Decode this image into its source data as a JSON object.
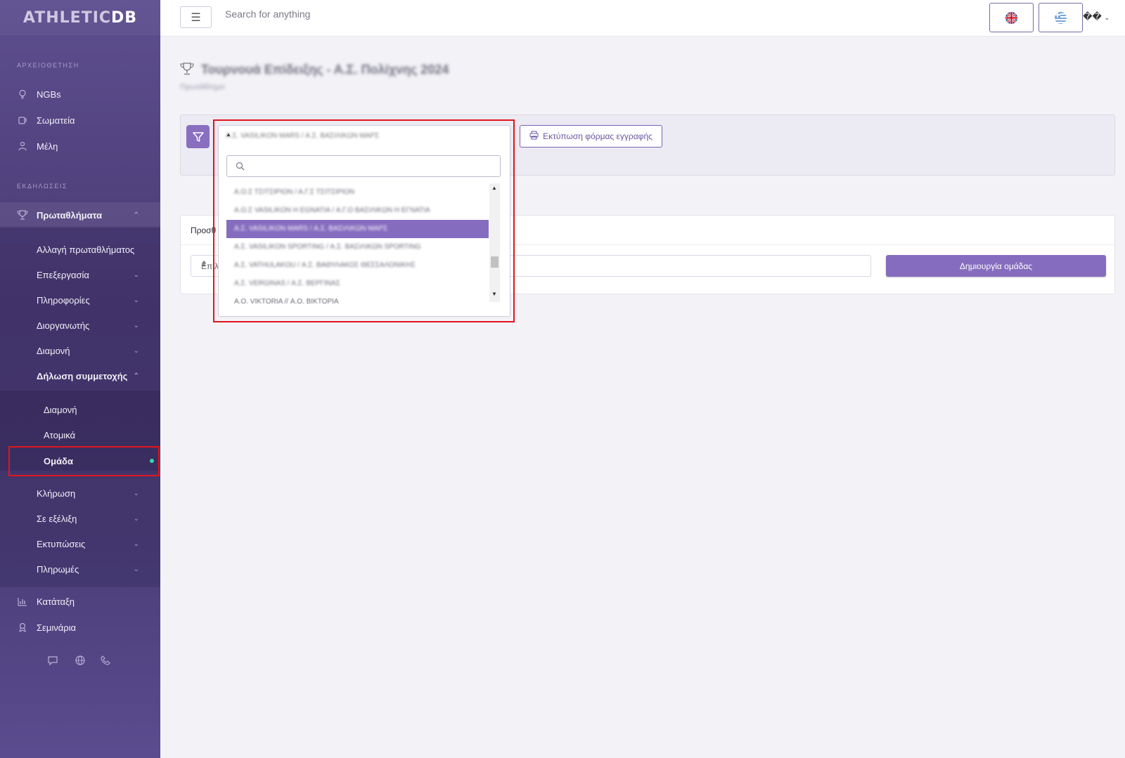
{
  "logo": {
    "part1": "ATHLETIC",
    "part2": "DB"
  },
  "sidebar": {
    "section_archive": "ΑΡΧΕΙΟΘΕΤΗΣΗ",
    "section_events": "ΕΚΔΗΛΩΣΕΙΣ",
    "ngbs": "NGBs",
    "clubs": "Σωματεία",
    "members": "Μέλη",
    "championships": "Πρωταθλήματα",
    "change_championship": "Αλλαγή πρωταθλήματος",
    "editing": "Επεξεργασία",
    "info": "Πληροφορίες",
    "organizer": "Διοργανωτής",
    "accommodation": "Διαμονή",
    "registration": "Δήλωση συμμετοχής",
    "reg_accommodation": "Διαμονή",
    "reg_individual": "Ατομικά",
    "reg_team": "Ομάδα",
    "draw": "Κλήρωση",
    "in_progress": "Σε εξέλιξη",
    "prints": "Εκτυπώσεις",
    "payments": "Πληρωμές",
    "ranking": "Κατάταξη",
    "seminars": "Σεμινάρια"
  },
  "header": {
    "search_placeholder": "Search for anything",
    "user_menu": "��"
  },
  "page": {
    "title": "Τουρνουά Επίδειξης - Α.Σ. Πολίχνης 2024",
    "subtitle": "Πρωτάθλημα"
  },
  "filter": {
    "selected": "Α.Σ. VASILIKON MARS / Α.Σ. ΒΑΣΙΛΙΚΩΝ ΜΑΡΣ",
    "print_button": "Εκτύπωση φόρμας εγγραφής"
  },
  "dropdown": {
    "search_value": "",
    "options": [
      "Α.Ο.Σ ΤΣΙΤΣΙΡΙΟΝ / Α.Γ.Σ ΤΣΙΤΣΙΡΙΟΝ",
      "Α.Ο.Σ VASILIKON H EGNATIA / Α.Γ.Ο ΒΑΣΙΛΙΚΩΝ Η ΕΓΝΑΤΙΑ",
      "Α.Σ. VASILIKON MARS / Α.Σ. ΒΑΣΙΛΙΚΩΝ ΜΑΡΣ",
      "Α.Σ. VASILIKON SPORTING / Α.Σ. ΒΑΣΙΛΙΚΩΝ SPORTING",
      "Α.Σ. VATHULAKOU / Α.Σ. ΒΑΘΥΛΑΚΟΣ ΘΕΣΣΑΛΟΝΙΚΗΣ",
      "Α.Σ. VERGINAS / Α.Σ. ΒΕΡΓΙΝΑΣ",
      "Α.Ο. VIKTORIA // Α.Ο. ΒΙΚΤΟΡΙΑ"
    ]
  },
  "team_card": {
    "header": "Προσθ",
    "select_placeholder": "Επιλ",
    "create_button": "Δημιουργία ομάδας"
  },
  "colors": {
    "accent": "#866cbf",
    "highlight_border": "#e2141c",
    "active_dot": "#3ad3b2"
  }
}
